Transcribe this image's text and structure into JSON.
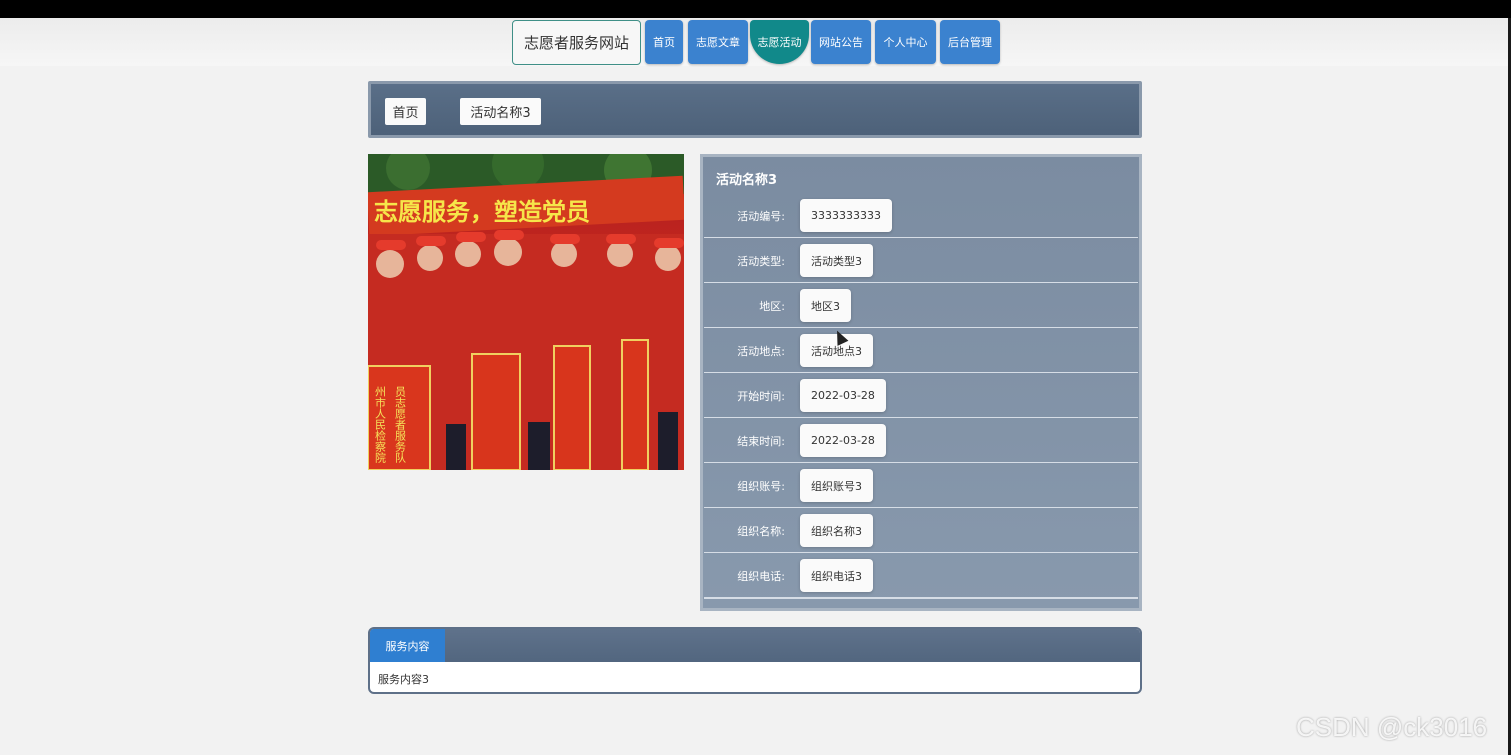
{
  "site": {
    "title": "志愿者服务网站"
  },
  "nav": [
    {
      "label": "首页",
      "active": false
    },
    {
      "label": "志愿文章",
      "active": false
    },
    {
      "label": "志愿活动",
      "active": true
    },
    {
      "label": "网站公告",
      "active": false
    },
    {
      "label": "个人中心",
      "active": false
    },
    {
      "label": "后台管理",
      "active": false
    }
  ],
  "breadcrumb": {
    "home": "首页",
    "current": "活动名称3"
  },
  "photo": {
    "banner_text": "志愿服务，塑造党员",
    "sign1": "州市人民检察院",
    "sign2": "员志愿者服务队"
  },
  "details": {
    "title": "活动名称3",
    "rows": [
      {
        "label": "活动编号:",
        "value": "3333333333"
      },
      {
        "label": "活动类型:",
        "value": "活动类型3"
      },
      {
        "label": "地区:",
        "value": "地区3"
      },
      {
        "label": "活动地点:",
        "value": "活动地点3"
      },
      {
        "label": "开始时间:",
        "value": "2022-03-28"
      },
      {
        "label": "结束时间:",
        "value": "2022-03-28"
      },
      {
        "label": "组织账号:",
        "value": "组织账号3"
      },
      {
        "label": "组织名称:",
        "value": "组织名称3"
      },
      {
        "label": "组织电话:",
        "value": "组织电话3"
      }
    ]
  },
  "tabs": {
    "active_label": "服务内容",
    "content": "服务内容3"
  },
  "watermark": "CSDN @ck3016"
}
